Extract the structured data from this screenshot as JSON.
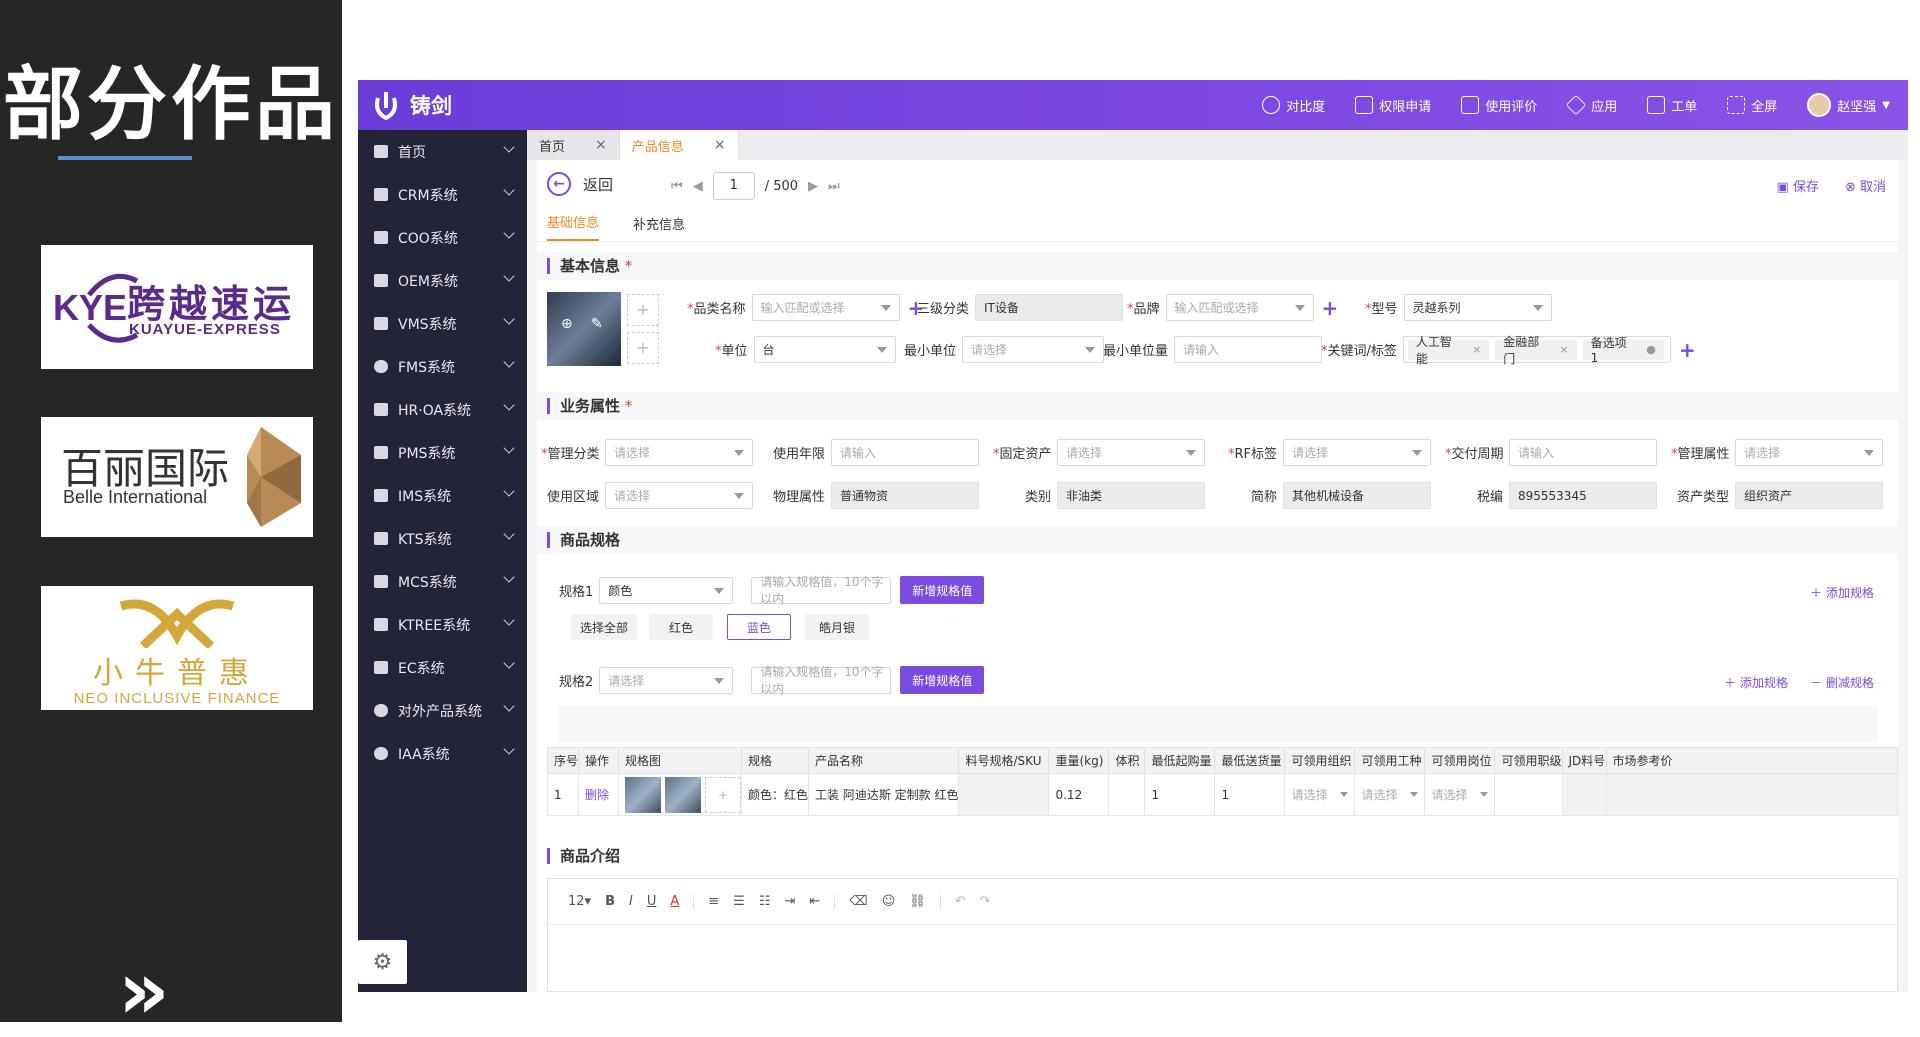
{
  "slide": {
    "title": "部分作品",
    "logos": {
      "kye": {
        "mark": "KYE",
        "cn": "跨越速运",
        "en": "KUAYUE-EXPRESS"
      },
      "belle": {
        "cn": "百丽国际",
        "en": "Belle International"
      },
      "niu": {
        "cn": "小牛普惠",
        "en": "NEO INCLUSIVE FINANCE"
      }
    },
    "next_glyph": "»"
  },
  "app": {
    "brand": "铸剑",
    "topbar": [
      {
        "label": "对比度",
        "icon": "contrast-icon"
      },
      {
        "label": "权限申请",
        "icon": "lock-icon"
      },
      {
        "label": "使用评价",
        "icon": "edit-icon"
      },
      {
        "label": "应用",
        "icon": "layers-icon"
      },
      {
        "label": "工单",
        "icon": "ticket-icon"
      },
      {
        "label": "全屏",
        "icon": "fullscreen-icon"
      }
    ],
    "user": "赵坚强",
    "sidebar": [
      "首页",
      "CRM系统",
      "COO系统",
      "OEM系统",
      "VMS系统",
      "FMS系统",
      "HR·OA系统",
      "PMS系统",
      "IMS系统",
      "KTS系统",
      "MCS系统",
      "KTREE系统",
      "EC系统",
      "对外产品系统",
      "IAA系统"
    ],
    "tabs": [
      {
        "label": "首页"
      },
      {
        "label": "产品信息"
      }
    ],
    "back": "返回",
    "pager": {
      "current": "1",
      "total": "/ 500"
    },
    "save": "保存",
    "cancel": "取消",
    "subtabs": [
      "基础信息",
      "补充信息"
    ],
    "sections": {
      "basic": "基本信息",
      "business": "业务属性",
      "spec": "商品规格",
      "intro": "商品介绍"
    },
    "basic": {
      "name": {
        "label": "品类名称",
        "ph": "输入匹配或选择"
      },
      "cat3": {
        "label": "三级分类",
        "value": "IT设备"
      },
      "brand": {
        "label": "品牌",
        "ph": "输入匹配或选择"
      },
      "model": {
        "label": "型号",
        "value": "灵越系列"
      },
      "unit": {
        "label": "单位",
        "value": "台"
      },
      "min_unit": {
        "label": "最小单位",
        "ph": "请选择"
      },
      "min_qty": {
        "label": "最小单位量",
        "ph": "请输入"
      },
      "keywords": {
        "label": "关键词/标签",
        "tags": [
          "人工智能",
          "金融部门",
          "备选项 1"
        ]
      }
    },
    "business": {
      "row1": [
        {
          "label": "管理分类",
          "ph": "请选择",
          "req": true,
          "dd": true
        },
        {
          "label": "使用年限",
          "ph": "请输入",
          "req": false,
          "dd": false
        },
        {
          "label": "固定资产",
          "ph": "请选择",
          "req": true,
          "dd": true
        },
        {
          "label": "RF标签",
          "ph": "请选择",
          "req": true,
          "dd": true
        },
        {
          "label": "交付周期",
          "ph": "请输入",
          "req": true,
          "dd": false
        },
        {
          "label": "管理属性",
          "ph": "请选择",
          "req": true,
          "dd": true
        }
      ],
      "row2": [
        {
          "label": "使用区域",
          "ph": "请选择",
          "dd": true
        },
        {
          "label": "物理属性",
          "value": "普通物资"
        },
        {
          "label": "类别",
          "value": "非油类"
        },
        {
          "label": "简称",
          "value": "其他机械设备"
        },
        {
          "label": "税编",
          "value": "895553345"
        },
        {
          "label": "资产类型",
          "value": "组织资产"
        }
      ]
    },
    "spec": {
      "spec1_label": "规格1",
      "spec1_value": "颜色",
      "spec2_label": "规格2",
      "spec2_ph": "请选择",
      "value_ph": "请输入规格值，10个字以内",
      "add_value": "新增规格值",
      "chips": [
        "选择全部",
        "红色",
        "蓝色",
        "皓月银"
      ],
      "add_spec": "添加规格",
      "remove_spec": "删减规格"
    },
    "table": {
      "headers": [
        "序号",
        "操作",
        "规格图",
        "规格",
        "产品名称",
        "料号规格/SKU",
        "重量(kg)",
        "体积",
        "最低起购量",
        "最低送货量",
        "可领用组织",
        "可领用工种",
        "可领用岗位",
        "可领用职级",
        "JD料号",
        "市场参考价"
      ],
      "row": {
        "no": "1",
        "op": "删除",
        "spec": "颜色：红色",
        "name": "工装 阿迪达斯 定制款 红色",
        "weight": "0.12",
        "min_buy": "1",
        "min_ship": "1",
        "ph": "请选择"
      }
    },
    "editor": {
      "font_size": "12"
    }
  }
}
